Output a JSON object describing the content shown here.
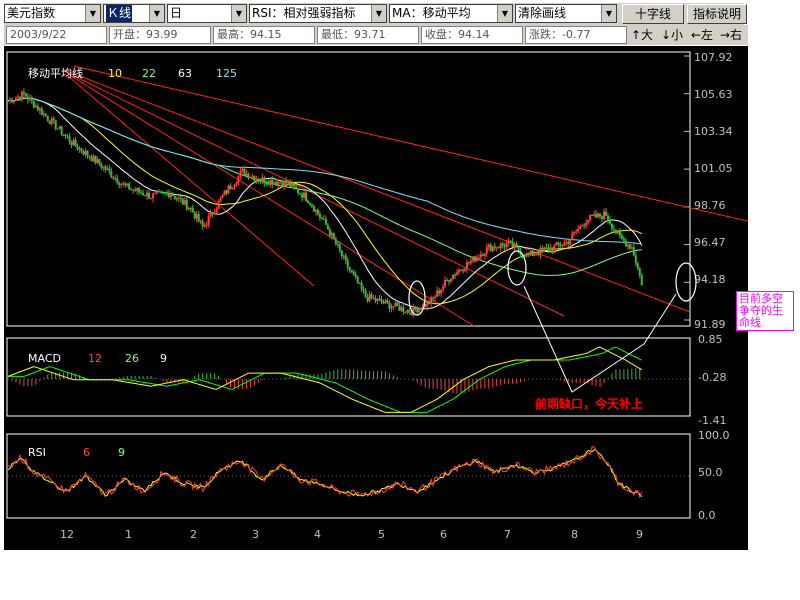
{
  "toolbar": {
    "instrument": "美元指数",
    "period_selected": "Ｋ线",
    "interval": "日",
    "indicator_rsi": "RSI：相对强弱指标",
    "indicator_ma": "MA：移动平均",
    "clear_lines": "清除画线",
    "crosshair_button": "十字线",
    "help_button": "指标说明"
  },
  "infobar": {
    "date": "2003/9/22",
    "open_label": "开盘：",
    "open": "93.99",
    "high_label": "最高：",
    "high": "94.15",
    "low_label": "最低：",
    "low": "93.71",
    "close_label": "收盘：",
    "close": "94.14",
    "change_label": "涨跌：",
    "change": "-0.77",
    "nav_up": "↑大",
    "nav_down": "↓小",
    "nav_left": "←左",
    "nav_right": "→右"
  },
  "colors": {
    "background": "#000000",
    "candle_up": "#ff4040",
    "candle_down": "#30c030",
    "trendline": "#ff2020",
    "ma10": "#ffffff",
    "ma22": "#ffff00",
    "ma63": "#80ff80",
    "ma125": "#80e0ff",
    "macd_line": "#ffff00",
    "signal_line": "#00ff00",
    "hist_pos": "#ff4040",
    "hist_neg": "#30c030",
    "annotation": "#ff0000",
    "note_box": "#ff00ff"
  },
  "main_panel": {
    "legend_title": "移动平均线",
    "ma_periods": [
      "10",
      "22",
      "63",
      "125"
    ],
    "y_ticks": [
      "107.92",
      "105.63",
      "103.34",
      "101.05",
      "98.76",
      "96.47",
      "94.18",
      "91.89"
    ]
  },
  "macd_panel": {
    "label": "MACD",
    "params": [
      "12",
      "26",
      "9"
    ],
    "y_ticks": [
      "0.85",
      "-0.28",
      "-1.41"
    ]
  },
  "rsi_panel": {
    "label": "RSI",
    "params": [
      "6",
      "9"
    ],
    "y_ticks": [
      "100.0",
      "50.0",
      "0.0"
    ]
  },
  "x_axis": {
    "months": [
      "12",
      "1",
      "2",
      "3",
      "4",
      "5",
      "6",
      "7",
      "8",
      "9"
    ]
  },
  "annotations": {
    "gap_note": "前期缺口，今天补上",
    "lifeline_note": "目前多空争夺的生命线"
  },
  "chart_data": {
    "type": "candlestick",
    "title": "",
    "ylim": [
      91.89,
      107.92
    ],
    "y_ticks": [
      107.92,
      105.63,
      103.34,
      101.05,
      98.76,
      96.47,
      94.18,
      91.89
    ],
    "x_ticks": [
      "12",
      "1",
      "2",
      "3",
      "4",
      "5",
      "6",
      "7",
      "8",
      "9"
    ],
    "last_bar": {
      "date": "2003/9/22",
      "open": 93.99,
      "high": 94.15,
      "low": 93.71,
      "close": 94.14,
      "change": -0.77
    },
    "macd": {
      "params": [
        12,
        26,
        9
      ],
      "ylim": [
        -1.41,
        0.85
      ],
      "y_ticks": [
        0.85,
        -0.28,
        -1.41
      ]
    },
    "rsi": {
      "params": [
        6,
        9
      ],
      "ylim": [
        0,
        100
      ],
      "y_ticks": [
        100.0,
        50.0,
        0.0
      ]
    },
    "moving_averages": [
      10,
      22,
      63,
      125
    ],
    "price_path": [
      [
        0,
        105.2
      ],
      [
        0.25,
        105.6
      ],
      [
        0.6,
        104.2
      ],
      [
        1.0,
        102.6
      ],
      [
        1.4,
        101.4
      ],
      [
        1.8,
        100.0
      ],
      [
        2.2,
        99.4
      ],
      [
        2.5,
        99.6
      ],
      [
        2.8,
        98.7
      ],
      [
        3.0,
        97.5
      ],
      [
        3.3,
        99.4
      ],
      [
        3.6,
        100.9
      ],
      [
        3.9,
        100.4
      ],
      [
        4.3,
        100.2
      ],
      [
        4.6,
        99.3
      ],
      [
        4.9,
        97.6
      ],
      [
        5.2,
        95.3
      ],
      [
        5.5,
        93.3
      ],
      [
        5.8,
        92.9
      ],
      [
        6.2,
        92.4
      ],
      [
        6.5,
        93.0
      ],
      [
        6.8,
        94.5
      ],
      [
        7.1,
        95.4
      ],
      [
        7.4,
        96.3
      ],
      [
        7.7,
        96.5
      ],
      [
        8.0,
        95.8
      ],
      [
        8.3,
        96.2
      ],
      [
        8.6,
        96.6
      ],
      [
        8.9,
        98.0
      ],
      [
        9.2,
        98.3
      ],
      [
        9.4,
        96.9
      ],
      [
        9.6,
        96.3
      ],
      [
        9.75,
        94.14
      ]
    ],
    "macd_path": [
      [
        0,
        -0.2
      ],
      [
        0.4,
        0.1
      ],
      [
        1.0,
        -0.3
      ],
      [
        1.6,
        -0.3
      ],
      [
        2.2,
        -0.5
      ],
      [
        2.7,
        -0.3
      ],
      [
        3.2,
        -0.6
      ],
      [
        3.7,
        -0.1
      ],
      [
        4.2,
        -0.1
      ],
      [
        4.8,
        -0.4
      ],
      [
        5.3,
        -0.9
      ],
      [
        5.8,
        -1.3
      ],
      [
        6.2,
        -1.3
      ],
      [
        6.6,
        -0.9
      ],
      [
        7.0,
        -0.3
      ],
      [
        7.4,
        0.1
      ],
      [
        7.8,
        0.3
      ],
      [
        8.4,
        0.3
      ],
      [
        8.9,
        0.5
      ],
      [
        9.1,
        0.7
      ],
      [
        9.5,
        0.3
      ],
      [
        9.75,
        0.0
      ]
    ],
    "rsi_path": [
      [
        0,
        60
      ],
      [
        0.2,
        75
      ],
      [
        0.4,
        55
      ],
      [
        0.6,
        45
      ],
      [
        0.9,
        30
      ],
      [
        1.2,
        50
      ],
      [
        1.5,
        25
      ],
      [
        1.8,
        45
      ],
      [
        2.1,
        30
      ],
      [
        2.4,
        55
      ],
      [
        2.7,
        40
      ],
      [
        3.0,
        35
      ],
      [
        3.3,
        60
      ],
      [
        3.6,
        70
      ],
      [
        3.9,
        45
      ],
      [
        4.2,
        65
      ],
      [
        4.5,
        45
      ],
      [
        4.8,
        40
      ],
      [
        5.1,
        30
      ],
      [
        5.4,
        25
      ],
      [
        5.7,
        30
      ],
      [
        6.0,
        40
      ],
      [
        6.3,
        30
      ],
      [
        6.6,
        45
      ],
      [
        6.9,
        60
      ],
      [
        7.2,
        70
      ],
      [
        7.5,
        55
      ],
      [
        7.8,
        65
      ],
      [
        8.1,
        55
      ],
      [
        8.4,
        60
      ],
      [
        8.7,
        70
      ],
      [
        9.0,
        85
      ],
      [
        9.2,
        70
      ],
      [
        9.4,
        40
      ],
      [
        9.6,
        30
      ],
      [
        9.75,
        25
      ]
    ]
  }
}
